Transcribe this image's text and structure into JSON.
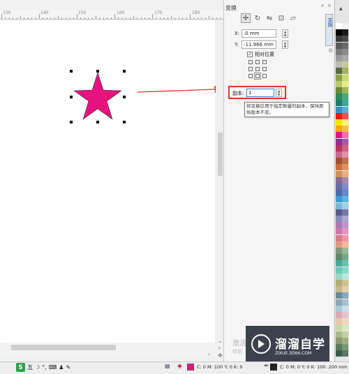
{
  "ruler": {
    "labels": [
      "130",
      "140",
      "150",
      "160",
      "170",
      "180"
    ]
  },
  "docker": {
    "title": "变换",
    "side_tab": "变换",
    "relative_position_label": "相对位置",
    "fields": [
      {
        "label": "X:",
        "value": ".0 mm"
      },
      {
        "label": "Y:",
        "value": "-11.966 mm"
      }
    ],
    "copies_label": "副本:",
    "copies_value": "1",
    "tooltip": "将变换应用于指定数量的副本，保持原始版本不变。",
    "apply_text": "激活",
    "apply_sub": "转到"
  },
  "star": {
    "fill": "#e5137e"
  },
  "watermark": {
    "title": "溜溜自学",
    "url": "ZIXUE.3D66.COM"
  },
  "status": {
    "ime_logo": "S",
    "ime_mode": "五",
    "fill_text": "C: 0 M: 100 Y: 0 K: 0",
    "outline_text": "C: 0 M: 0 Y: 0 K: 100 .200 mm"
  },
  "colors": {
    "accent_red": "#e63028",
    "magenta": "#e5137e"
  }
}
